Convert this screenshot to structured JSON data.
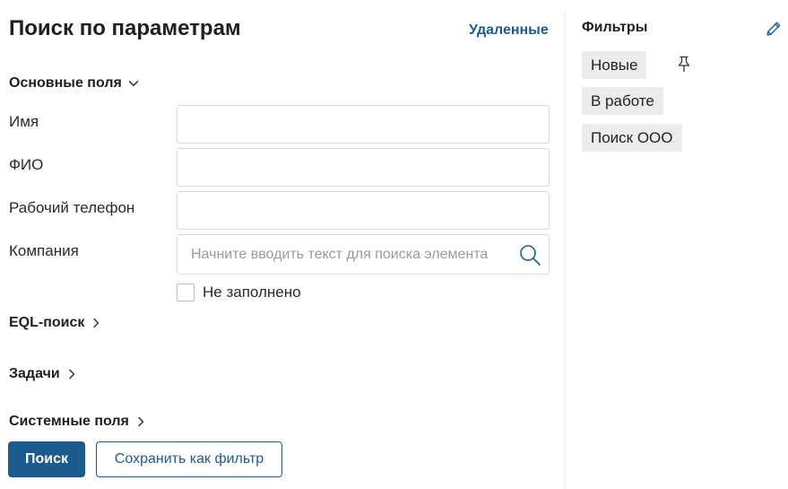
{
  "header": {
    "title": "Поиск по параметрам",
    "deleted_link": "Удаленные"
  },
  "sections": {
    "main_fields": "Основные поля",
    "eql_search": "EQL-поиск",
    "tasks": "Задачи",
    "system_fields": "Системные поля"
  },
  "fields": {
    "name": {
      "label": "Имя",
      "value": ""
    },
    "full_name": {
      "label": "ФИО",
      "value": ""
    },
    "work_phone": {
      "label": "Рабочий телефон",
      "value": ""
    },
    "company": {
      "label": "Компания",
      "placeholder": "Начните вводить текст для поиска элемента",
      "value": ""
    }
  },
  "not_filled": {
    "label": "Не заполнено",
    "checked": false
  },
  "buttons": {
    "search": "Поиск",
    "save_filter": "Сохранить как фильтр"
  },
  "filters_panel": {
    "title": "Фильтры",
    "items": [
      {
        "label": "Новые",
        "pinned": true
      },
      {
        "label": "В работе",
        "pinned": false
      },
      {
        "label": "Поиск ООО",
        "pinned": false
      }
    ]
  },
  "icons": {
    "section_expanded": "chevron-down-icon",
    "section_collapsed": "chevron-right-icon",
    "company_search": "search-icon",
    "filters_edit": "pencil-icon",
    "filter_pin": "pin-icon"
  },
  "colors": {
    "accent": "#1d5b8c",
    "chip_bg": "#ececec",
    "border": "#d9d9d9"
  }
}
